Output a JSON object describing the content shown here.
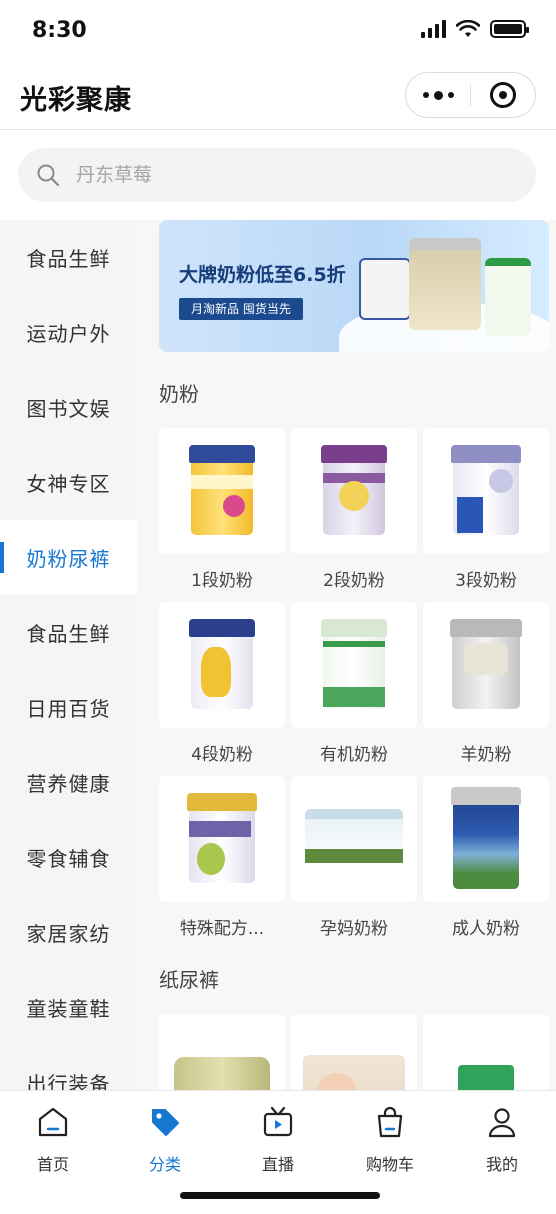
{
  "status_bar": {
    "time": "8:30"
  },
  "header": {
    "title": "光彩聚康"
  },
  "search": {
    "placeholder": "丹东草莓"
  },
  "sidebar": {
    "items": [
      {
        "label": "食品生鲜"
      },
      {
        "label": "运动户外"
      },
      {
        "label": "图书文娱"
      },
      {
        "label": "女神专区"
      },
      {
        "label": "奶粉尿裤",
        "active": true
      },
      {
        "label": "食品生鲜"
      },
      {
        "label": "日用百货"
      },
      {
        "label": "营养健康"
      },
      {
        "label": "零食辅食"
      },
      {
        "label": "家居家纺"
      },
      {
        "label": "童装童鞋"
      },
      {
        "label": "出行装备"
      }
    ]
  },
  "banner": {
    "title": "大牌奶粉低至6.5折",
    "subtitle": "月淘新品 囤货当先"
  },
  "sections": [
    {
      "title": "奶粉",
      "products": [
        {
          "label": "1段奶粉"
        },
        {
          "label": "2段奶粉"
        },
        {
          "label": "3段奶粉"
        },
        {
          "label": "4段奶粉"
        },
        {
          "label": "有机奶粉"
        },
        {
          "label": "羊奶粉"
        },
        {
          "label": "特殊配方..."
        },
        {
          "label": "孕妈奶粉"
        },
        {
          "label": "成人奶粉"
        }
      ]
    },
    {
      "title": "纸尿裤",
      "products": [
        {
          "label": ""
        },
        {
          "label": ""
        },
        {
          "label": ""
        }
      ]
    }
  ],
  "tabbar": {
    "items": [
      {
        "label": "首页",
        "icon": "home-icon"
      },
      {
        "label": "分类",
        "icon": "tag-icon",
        "active": true
      },
      {
        "label": "直播",
        "icon": "tv-icon"
      },
      {
        "label": "购物车",
        "icon": "bag-icon"
      },
      {
        "label": "我的",
        "icon": "user-icon"
      }
    ]
  },
  "colors": {
    "accent": "#1677d2",
    "sidebar_bg": "#f5f5f5",
    "content_bg": "#f7f7f7"
  }
}
